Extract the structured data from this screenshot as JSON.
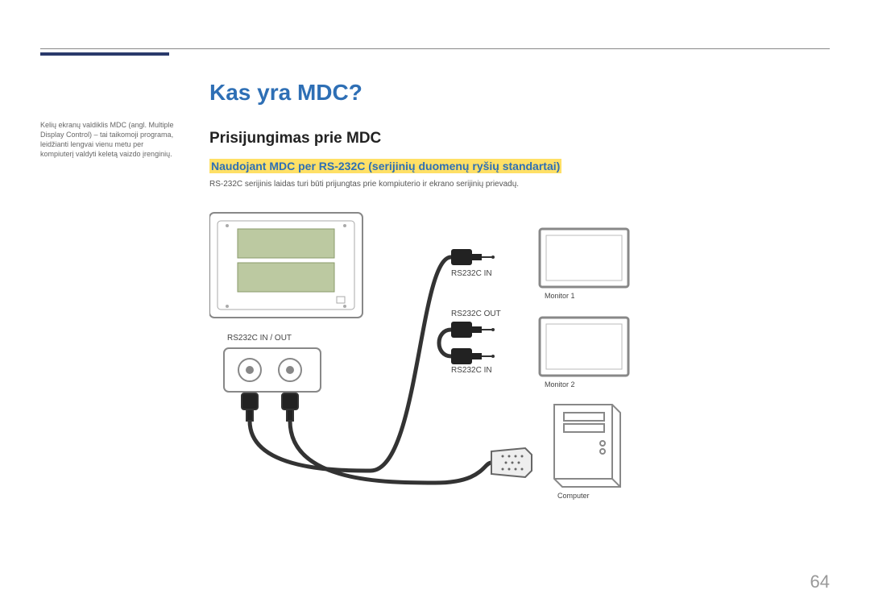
{
  "sidebar_note": "Kelių ekranų valdiklis MDC (angl. Multiple Display Control) – tai taikomoji programa, leidžianti lengvai vienu metu per kompiuterį valdyti keletą vaizdo įrenginių.",
  "title": "Kas yra MDC?",
  "section_heading": "Prisijungimas prie MDC",
  "sub_heading": "Naudojant MDC per RS-232C (serijinių duomenų ryšių standartai)",
  "body": "RS-232C serijinis laidas turi būti prijungtas prie kompiuterio ir ekrano serijinių prievadų.",
  "labels": {
    "ports_header": "RS232C IN / OUT",
    "rs_in_1": "RS232C IN",
    "rs_out": "RS232C OUT",
    "rs_in_2": "RS232C IN",
    "monitor1": "Monitor 1",
    "monitor2": "Monitor 2",
    "computer": "Computer"
  },
  "page_number": "64"
}
